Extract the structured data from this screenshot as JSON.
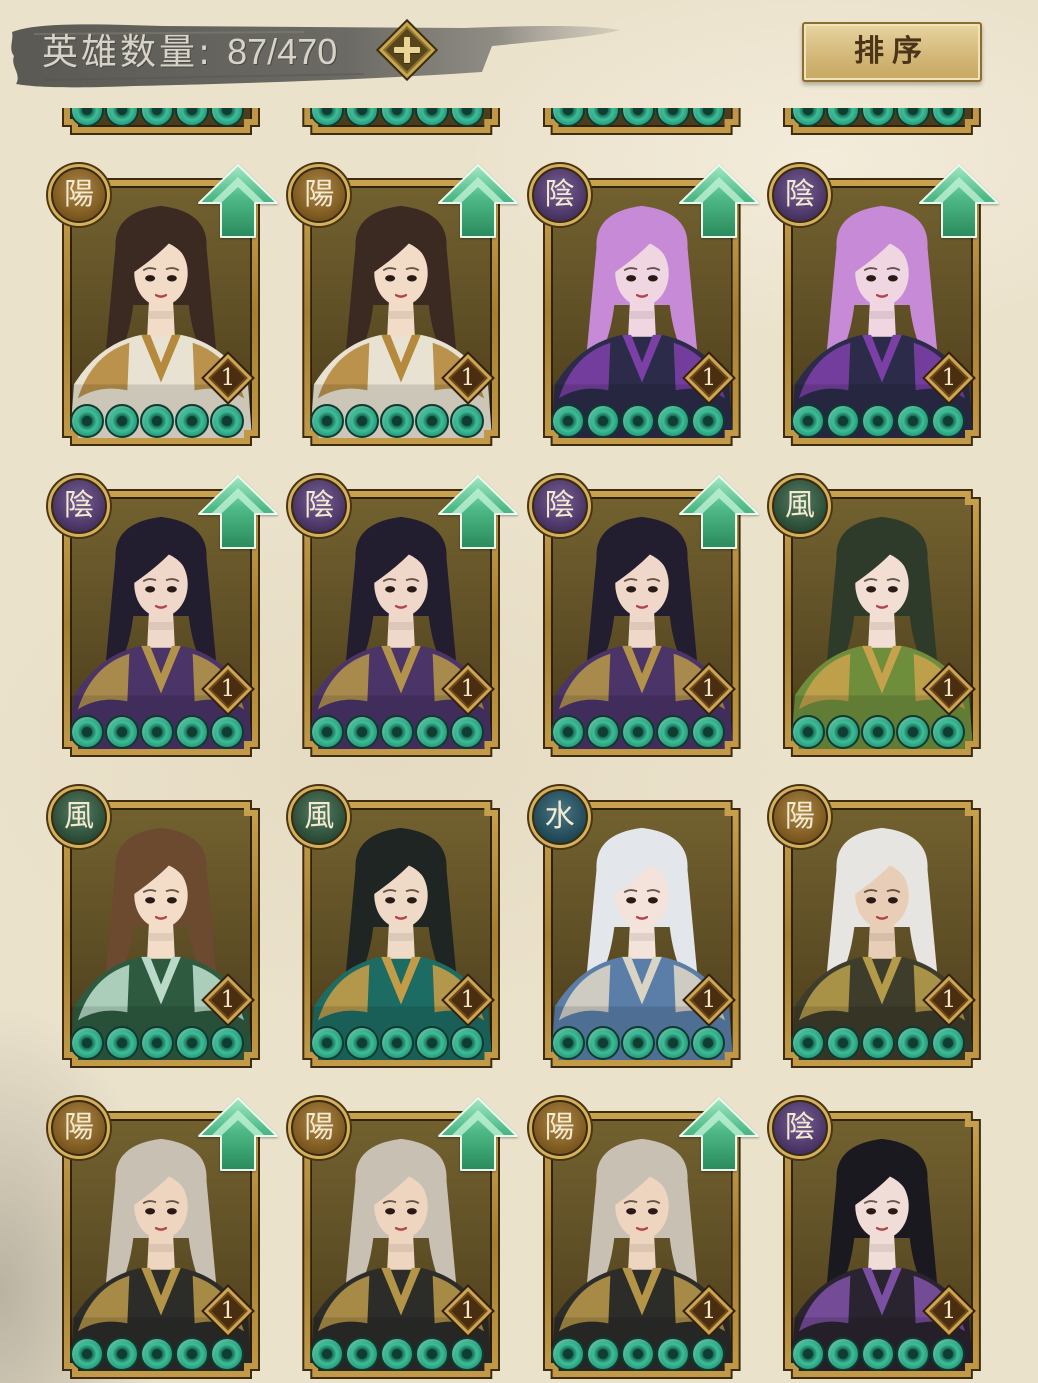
{
  "header": {
    "hero_count_label": "英雄数量:",
    "hero_count_value": "87/470",
    "add_icon": "plus-icon",
    "sort_label": "排序"
  },
  "colors": {
    "background": "#ebe2cc",
    "card_background": "#5e4e25",
    "frame_gold": "#c9a24f",
    "upgrade_arrow": "#4fb987",
    "star_coin": "#3cbf98"
  },
  "element_colors": {
    "陽": "#9a6a1c",
    "陰": "#55397a",
    "風": "#2d5b3d",
    "水": "#1f5567"
  },
  "grid": {
    "cards": [
      {
        "stars": 5
      },
      {
        "stars": 5
      },
      {
        "stars": 5
      },
      {
        "stars": 5
      },
      {
        "element": "陽",
        "level": "1",
        "stars": 5,
        "upgrade": true,
        "art": {
          "hair": "#3b2a22",
          "skin": "#f2dcc7",
          "outfit": "#e8e2d2",
          "accent": "#b58a3c"
        }
      },
      {
        "element": "陽",
        "level": "1",
        "stars": 5,
        "upgrade": true,
        "art": {
          "hair": "#3b2a22",
          "skin": "#f2dcc7",
          "outfit": "#e8e2d2",
          "accent": "#b58a3c"
        }
      },
      {
        "element": "陰",
        "level": "1",
        "stars": 5,
        "upgrade": true,
        "art": {
          "hair": "#c78ad6",
          "skin": "#efd6e0",
          "outfit": "#2c2c4a",
          "accent": "#7b3fa6"
        }
      },
      {
        "element": "陰",
        "level": "1",
        "stars": 5,
        "upgrade": true,
        "art": {
          "hair": "#c78ad6",
          "skin": "#efd6e0",
          "outfit": "#2c2c4a",
          "accent": "#7b3fa6"
        }
      },
      {
        "element": "陰",
        "level": "1",
        "stars": 5,
        "upgrade": true,
        "art": {
          "hair": "#221e30",
          "skin": "#efd8c9",
          "outfit": "#4b3468",
          "accent": "#b3934a"
        }
      },
      {
        "element": "陰",
        "level": "1",
        "stars": 5,
        "upgrade": true,
        "art": {
          "hair": "#221e30",
          "skin": "#efd8c9",
          "outfit": "#4b3468",
          "accent": "#b3934a"
        }
      },
      {
        "element": "陰",
        "level": "1",
        "stars": 5,
        "upgrade": true,
        "art": {
          "hair": "#221e30",
          "skin": "#efd8c9",
          "outfit": "#4b3468",
          "accent": "#b3934a"
        }
      },
      {
        "element": "風",
        "level": "1",
        "stars": 5,
        "upgrade": false,
        "art": {
          "hair": "#2e3a2a",
          "skin": "#f2ded2",
          "outfit": "#6f8e3c",
          "accent": "#c6a24c"
        }
      },
      {
        "element": "風",
        "level": "1",
        "stars": 5,
        "upgrade": false,
        "art": {
          "hair": "#6b4a2f",
          "skin": "#f3ddc9",
          "outfit": "#2e5a3f",
          "accent": "#b9dac9"
        }
      },
      {
        "element": "風",
        "level": "1",
        "stars": 5,
        "upgrade": false,
        "art": {
          "hair": "#1e2523",
          "skin": "#efd9c7",
          "outfit": "#1d6c64",
          "accent": "#c49c48"
        }
      },
      {
        "element": "水",
        "level": "1",
        "stars": 5,
        "upgrade": false,
        "art": {
          "hair": "#e3e6eb",
          "skin": "#f4e3da",
          "outfit": "#5b7ea8",
          "accent": "#d9d4c4"
        }
      },
      {
        "element": "陽",
        "level": "1",
        "stars": 5,
        "upgrade": false,
        "art": {
          "hair": "#e7e5e1",
          "skin": "#e8ceb7",
          "outfit": "#3e3d2b",
          "accent": "#b49b4a"
        }
      },
      {
        "element": "陽",
        "level": "1",
        "stars": 5,
        "upgrade": true,
        "art": {
          "hair": "#c9c0b4",
          "skin": "#eed5bf",
          "outfit": "#2c2c29",
          "accent": "#b49548"
        }
      },
      {
        "element": "陽",
        "level": "1",
        "stars": 5,
        "upgrade": true,
        "art": {
          "hair": "#c9c0b4",
          "skin": "#eed5bf",
          "outfit": "#2c2c29",
          "accent": "#b49548"
        }
      },
      {
        "element": "陽",
        "level": "1",
        "stars": 5,
        "upgrade": true,
        "art": {
          "hair": "#c9c0b4",
          "skin": "#eed5bf",
          "outfit": "#2c2c29",
          "accent": "#b49548"
        }
      },
      {
        "element": "陰",
        "level": "1",
        "stars": 5,
        "upgrade": false,
        "art": {
          "hair": "#1a1920",
          "skin": "#f1ddd8",
          "outfit": "#29242f",
          "accent": "#7b50a2"
        }
      }
    ]
  }
}
